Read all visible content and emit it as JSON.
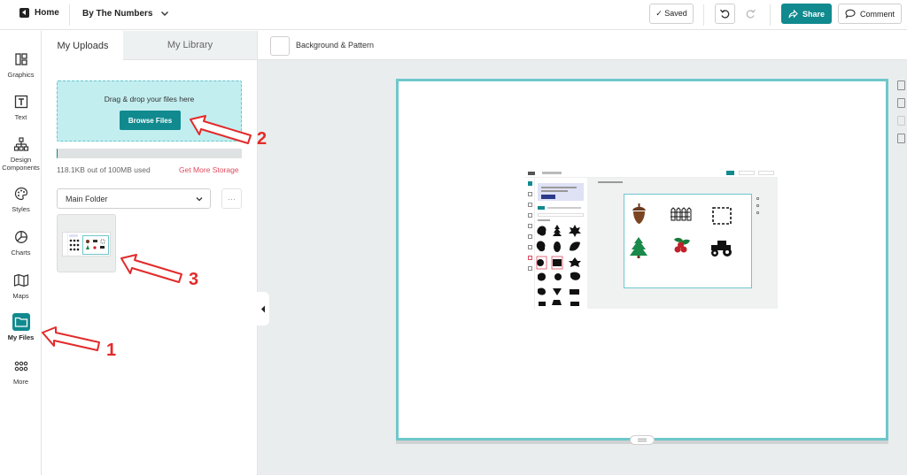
{
  "topbar": {
    "home_label": "Home",
    "doc_title": "By The Numbers",
    "saved_label": "✓ Saved",
    "share_label": "Share",
    "comment_label": "Comment"
  },
  "rail": {
    "items": [
      {
        "label": "Graphics",
        "icon": "graphics-icon"
      },
      {
        "label": "Text",
        "icon": "text-icon"
      },
      {
        "label": "Design Components",
        "icon": "design-components-icon"
      },
      {
        "label": "Styles",
        "icon": "palette-icon"
      },
      {
        "label": "Charts",
        "icon": "pie-chart-icon"
      },
      {
        "label": "Maps",
        "icon": "map-icon"
      },
      {
        "label": "My Files",
        "icon": "folder-icon",
        "active": true
      },
      {
        "label": "More",
        "icon": "grid-icon"
      }
    ]
  },
  "panel": {
    "tabs": [
      "My Uploads",
      "My Library"
    ],
    "active_tab": "My Uploads",
    "dropzone_text": "Drag & drop your files here",
    "browse_label": "Browse Files",
    "storage_fraction": 0.0012,
    "storage_used": "118.1KB out of 100MB used",
    "get_more_storage": "Get More Storage",
    "folder_selected": "Main Folder",
    "more_label": "···"
  },
  "canvas": {
    "background_label": "Background & Pattern"
  },
  "annotations": [
    "1",
    "2",
    "3"
  ],
  "colors": {
    "accent": "#108a8f",
    "dropzone": "#c3eef0",
    "link": "#e04a5c",
    "annotation": "#e32a2a",
    "page_border": "#6fc7cb"
  }
}
